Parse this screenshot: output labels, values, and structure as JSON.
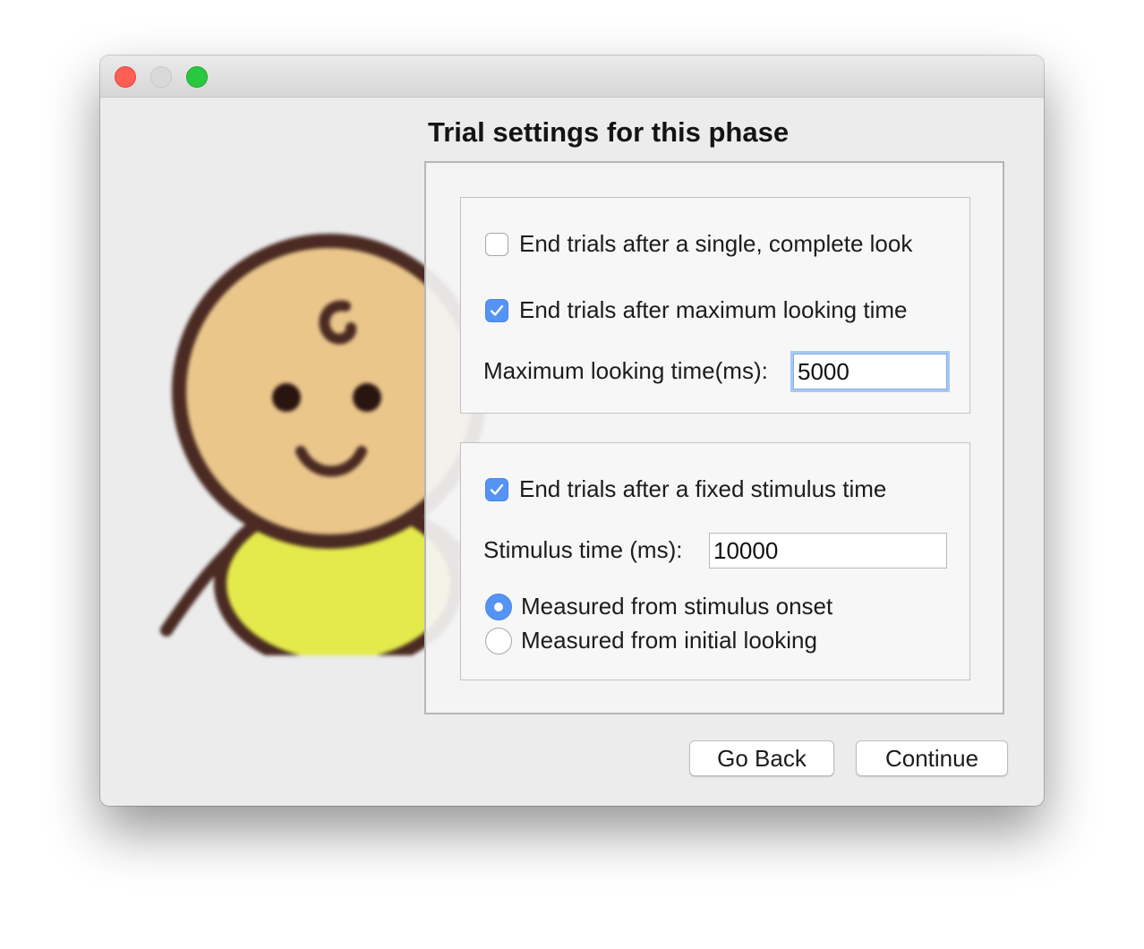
{
  "window": {
    "traffic_lights": [
      "close",
      "minimize",
      "zoom"
    ]
  },
  "colors": {
    "accent": "#5593f4",
    "face": "#eac68b",
    "outline": "#4a2a22",
    "bib": "#e4ea4c"
  },
  "heading": "Trial settings for this phase",
  "looking_group": {
    "single_look": {
      "label": "End trials after a single, complete look",
      "checked": false
    },
    "max_looking": {
      "label": "End trials after maximum looking time",
      "checked": true
    },
    "max_time_label": "Maximum looking time(ms):",
    "max_time_value": "5000"
  },
  "stimulus_group": {
    "fixed_stimulus": {
      "label": "End trials after a fixed stimulus time",
      "checked": true
    },
    "stimulus_time_label": "Stimulus time (ms):",
    "stimulus_time_value": "10000",
    "measure_options": [
      {
        "label": "Measured from stimulus onset",
        "selected": true
      },
      {
        "label": "Measured from initial looking",
        "selected": false
      }
    ]
  },
  "buttons": {
    "back": "Go Back",
    "continue": "Continue"
  },
  "icons": {
    "checkmark": "checkmark-icon",
    "mascot": "baby-mascot-icon"
  }
}
